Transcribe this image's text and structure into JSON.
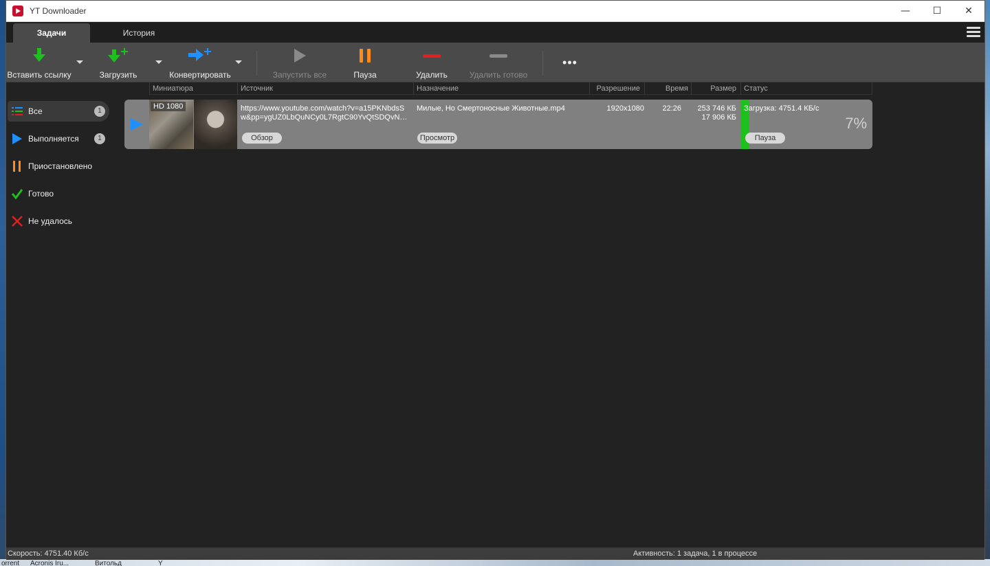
{
  "window": {
    "title": "YT Downloader",
    "minimize": "—",
    "maximize": "☐",
    "close": "✕"
  },
  "tabs": [
    {
      "label": "Задачи",
      "active": true
    },
    {
      "label": "История",
      "active": false
    }
  ],
  "toolbar": {
    "paste_link": "Вставить ссылку",
    "download": "Загрузить",
    "convert": "Конвертировать",
    "start_all": "Запустить все",
    "pause": "Пауза",
    "delete": "Удалить",
    "delete_done": "Удалить готово",
    "more": "•••"
  },
  "sidebar": {
    "items": [
      {
        "label": "Все",
        "count": "1",
        "icon": "list-icon"
      },
      {
        "label": "Выполняется",
        "count": "1",
        "icon": "play-icon"
      },
      {
        "label": "Приостановлено",
        "icon": "pause-icon"
      },
      {
        "label": "Готово",
        "icon": "check-icon"
      },
      {
        "label": "Не удалось",
        "icon": "x-icon"
      }
    ]
  },
  "columns": {
    "thumbnail": "Миниатюра",
    "source": "Источник",
    "destination": "Назначение",
    "resolution": "Разрешение",
    "time": "Время",
    "size": "Размер",
    "status": "Статус"
  },
  "task": {
    "hd_badge": "HD 1080",
    "source_line1": "https://www.youtube.com/watch?v=a15PKNbdsS",
    "source_line2": "w&pp=ygUZ0LbQuNCy0L7RgtC90YvQtSDQvNC...",
    "browse": "Обзор",
    "destination": "Милые, Но Смертоносные Животные.mp4",
    "view": "Просмотр",
    "resolution": "1920x1080",
    "time": "22:26",
    "size_total": "253 746 КБ",
    "size_done": "17 906 КБ",
    "status_text": "Загрузка: 4751.4 КБ/с",
    "pause_btn": "Пауза",
    "percent": "7%",
    "progress": 0.07
  },
  "statusbar": {
    "speed": "Скорость: 4751.40 Кб/с",
    "activity": "Активность: 1 задача, 1 в процессе"
  },
  "taskbar": {
    "item1": "orrent",
    "item2": "Acronis Iru...",
    "item3": "Витольд",
    "item4": "Y"
  },
  "colors": {
    "accent_green": "#1ec01e",
    "accent_blue": "#1e90ff",
    "accent_orange": "#ff8c1a",
    "accent_red": "#e0201e"
  }
}
